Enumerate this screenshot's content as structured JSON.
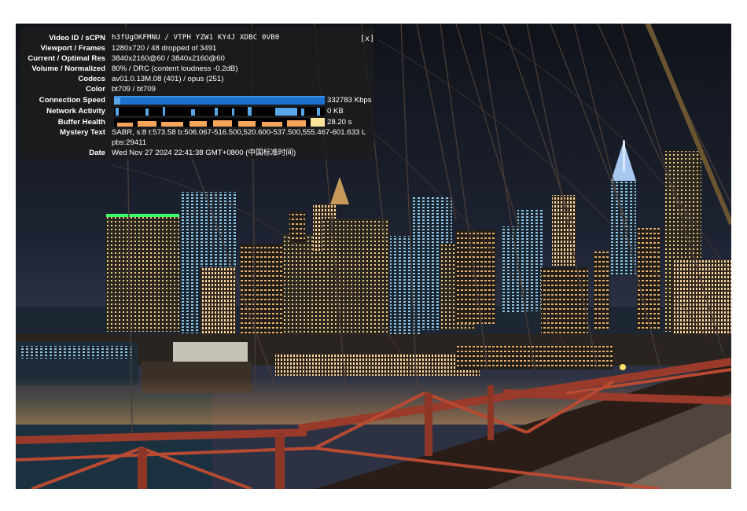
{
  "stats": {
    "close_label": "[x]",
    "rows": {
      "video_id": {
        "label": "Video ID / sCPN",
        "value": "h3fUgOKFMNU / VTPH YZW1 KY4J XDBC 0VB0"
      },
      "viewport": {
        "label": "Viewport / Frames",
        "value": "1280x720 / 48 dropped of 3491"
      },
      "resolution": {
        "label": "Current / Optimal Res",
        "value": "3840x2160@60 / 3840x2160@60"
      },
      "volume": {
        "label": "Volume / Normalized",
        "value": "80% / DRC (content loudness -0.2dB)"
      },
      "codecs": {
        "label": "Codecs",
        "value": "av01.0.13M.08 (401) / opus (251)"
      },
      "color": {
        "label": "Color",
        "value": "bt709 / bt709"
      },
      "connection": {
        "label": "Connection Speed",
        "value": "332783 Kbps"
      },
      "network": {
        "label": "Network Activity",
        "value": "0 KB"
      },
      "buffer": {
        "label": "Buffer Health",
        "value": "28.20 s"
      },
      "mystery": {
        "label": "Mystery Text",
        "value": "SABR, s:8 t:573.58 b:506.067-516.500,520.600-537.500,555.467-601.633 L pbs:29411"
      },
      "date": {
        "label": "Date",
        "value": "Wed Nov 27 2024 22:41:38 GMT+0800 (中国标准时间)"
      }
    }
  },
  "colors": {
    "panel_bg": "#1c1c1c",
    "connection_graph": "#1a6fcf",
    "network_graph": "#5aa7e8",
    "buffer_graph": "#f5a65b"
  }
}
